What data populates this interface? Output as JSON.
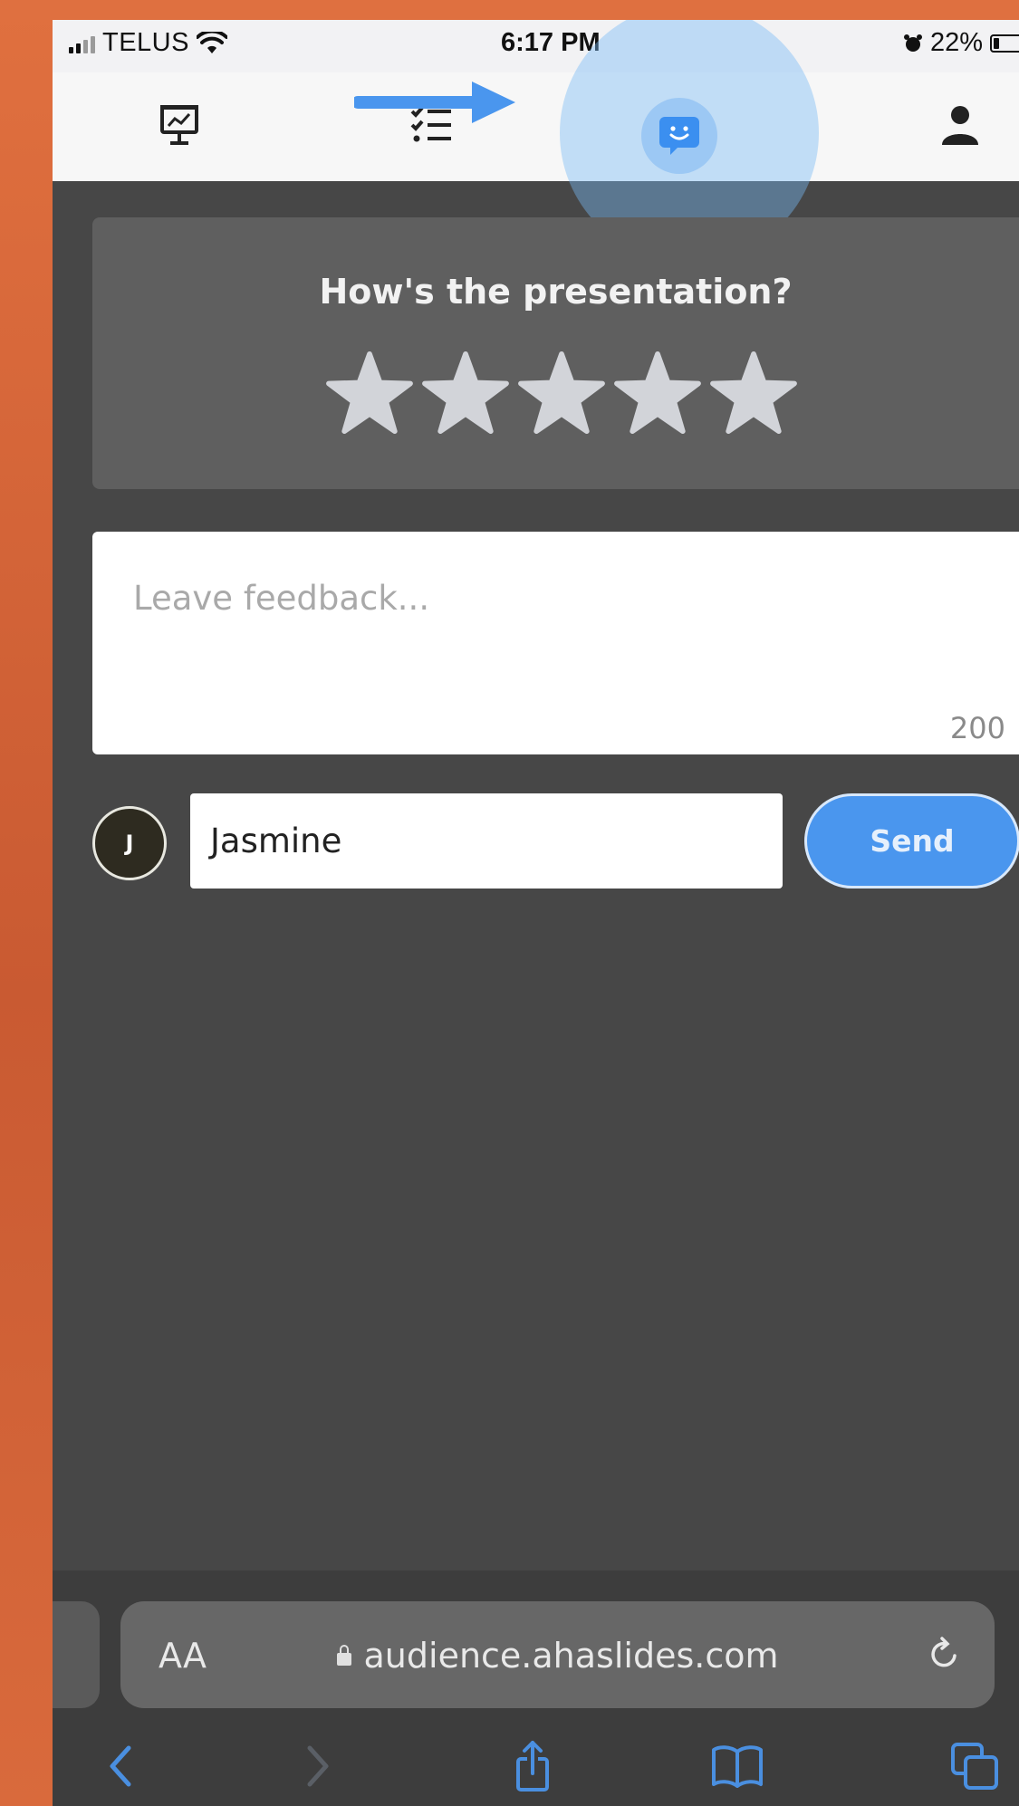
{
  "status_bar": {
    "carrier": "TELUS",
    "time": "6:17 PM",
    "battery": "22%"
  },
  "nav": {
    "items": [
      {
        "icon": "presentation-icon"
      },
      {
        "icon": "quiz-list-icon"
      },
      {
        "icon": "feedback-chat-icon",
        "active": true
      },
      {
        "icon": "profile-icon"
      }
    ],
    "accent": "#4a96ee"
  },
  "rating": {
    "title": "How's the presentation?",
    "stars_total": 5,
    "stars_selected": 0
  },
  "feedback": {
    "placeholder": "Leave feedback...",
    "char_limit": "200"
  },
  "user": {
    "initial": "J",
    "name": "Jasmine"
  },
  "send_label": "Send",
  "browser": {
    "text_size_label": "AA",
    "url": "audience.ahaslides.com"
  }
}
